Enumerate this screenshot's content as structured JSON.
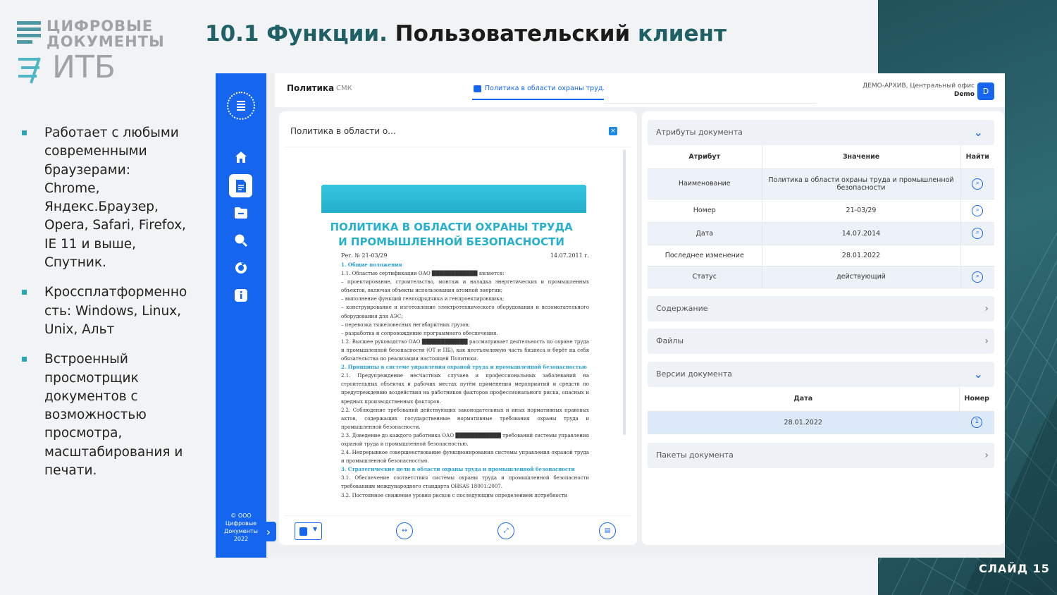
{
  "slide": {
    "title_prefix": "10.1 Функции.",
    "title_mid": " Пользовательский ",
    "title_accent": "клиент",
    "logo_line1": "ЦИФРОВЫЕ",
    "logo_line2": "ДОКУМЕНТЫ",
    "logo_itb": "ИТБ",
    "bullets": [
      "Работает с любыми современными браузерами: Chrome, Яндекс.Браузер, Opera, Safari, Firefox, IE 11 и выше, Спутник.",
      "Кроссплатформенность: Windows, Linux, Unix, Альт",
      "Встроенный просмотрщик документов с возможностью просмотра, масштабирования и печати."
    ],
    "slide_number": "СЛАЙД 15",
    "accent_color": "#1f5f66",
    "bullet_color": "#2aa7b4"
  },
  "app": {
    "sidebar": {
      "icons": [
        "home-icon",
        "document-icon",
        "folder-icon",
        "search-icon",
        "refresh-icon",
        "info-icon"
      ],
      "copyright": "© ООО Цифровые Документы 2022",
      "brand_color": "#1565ee"
    },
    "topbar": {
      "title": "Политика",
      "subtitle": "СМК",
      "tab_label": "Политика в области охраны труд...",
      "archive": "ДЕМО-АРХИВ, Центральный офис",
      "user": "Demo",
      "avatar_letter": "D"
    },
    "viewer": {
      "heading": "Политика в области о...",
      "close_label": "×",
      "doc_title_1": "ПОЛИТИКА В ОБЛАСТИ ОХРАНЫ ТРУДА",
      "doc_title_2": "И ПРОМЫШЛЕННОЙ БЕЗОПАСНОСТИ",
      "reg_no": "Рег. № 21-03/29",
      "reg_date": "14.07.2011 г.",
      "body": [
        {
          "type": "h",
          "text": "1. Общие положения"
        },
        {
          "type": "p",
          "text": "1.1. Областью сертификации ОАО ████████████ является:"
        },
        {
          "type": "p",
          "text": "– проектирование, строительство, монтаж и наладка энергетических и промышленных объектов, включая объекты использования атомной энергии;"
        },
        {
          "type": "p",
          "text": "– выполнение функций генподрядчика и генпроектировщика;"
        },
        {
          "type": "p",
          "text": "– конструирование и изготовление электротехнического оборудования и вспомогательного оборудования для АЭС;"
        },
        {
          "type": "p",
          "text": "– перевозка тяжеловесных негабаритных грузов;"
        },
        {
          "type": "p",
          "text": "– разработка и сопровождение программного обеспечения."
        },
        {
          "type": "p",
          "text": "1.2. Высшее руководство ОАО ████████████ рассматривает деятельность по охране труда и промышленной безопасности (ОТ и ПБ), как неотъемлемую часть бизнеса и берёт на себя обязательства по реализации настоящей Политики."
        },
        {
          "type": "h",
          "text": "2. Принципы в системе управления охраной труда и промышленной безопасностью"
        },
        {
          "type": "p",
          "text": "2.1. Предупреждение несчастных случаев и профессиональных заболеваний на строительных объектах и рабочих местах путём применения мероприятий и средств по предупреждению воздействия на работников факторов профессионального риска, опасных и вредных производственных факторов."
        },
        {
          "type": "p",
          "text": "2.2. Соблюдение требований действующих законодательных и иных нормативных правовых актов, содержащих государственные нормативные требования охраны труда и промышленной безопасности."
        },
        {
          "type": "p",
          "text": "2.3. Доведение до каждого работника ОАО ████████████ требований системы управления охраной труда и промышленной безопасностью."
        },
        {
          "type": "p",
          "text": "2.4. Непрерывное совершенствование функционирования системы управления охраной труда и промышленной безопасностью."
        },
        {
          "type": "h",
          "text": "3. Стратегические цели в области охраны труда и промышленной безопасности"
        },
        {
          "type": "p",
          "text": "3.1. Обеспечение соответствия системы охраны труда и промышленной безопасности требованиям международного стандарта OHSAS 18001:2007."
        },
        {
          "type": "p",
          "text": "3.2. Постоянное снижение уровня рисков с последующим определением потребности"
        }
      ],
      "tools": [
        "file-menu",
        "fit-width-icon",
        "fullscreen-icon",
        "print-icon"
      ]
    },
    "attributes": {
      "section_title": "Атрибуты документа",
      "columns": [
        "Атрибут",
        "Значение",
        "Найти"
      ],
      "rows": [
        {
          "attr": "Наименование",
          "value": "Политика в области охраны труда и промышленной безопасности",
          "findable": true
        },
        {
          "attr": "Номер",
          "value": "21-03/29",
          "findable": true
        },
        {
          "attr": "Дата",
          "value": "14.07.2014",
          "findable": true
        },
        {
          "attr": "Последнее изменение",
          "value": "28.01.2022",
          "findable": false
        },
        {
          "attr": "Статус",
          "value": "действующий",
          "findable": true
        }
      ],
      "content_title": "Содержание",
      "files_title": "Файлы",
      "versions_title": "Версии документа",
      "versions_columns": [
        "Дата",
        "Номер"
      ],
      "versions_rows": [
        {
          "date": "28.01.2022",
          "number": "1"
        }
      ],
      "packages_title": "Пакеты документа"
    }
  }
}
